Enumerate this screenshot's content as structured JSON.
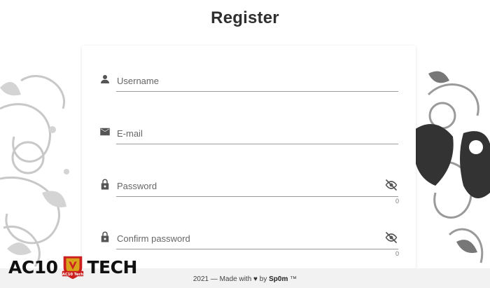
{
  "page": {
    "title": "Register"
  },
  "form": {
    "username": {
      "placeholder": "Username",
      "icon": "person-icon"
    },
    "email": {
      "placeholder": "E-mail",
      "icon": "mail-icon"
    },
    "password": {
      "placeholder": "Password",
      "icon": "lock-icon",
      "counter": "0",
      "toggle_icon": "eye-off-icon"
    },
    "confirm_password": {
      "placeholder": "Confirm password",
      "icon": "lock-icon",
      "counter": "0",
      "toggle_icon": "eye-off-icon"
    }
  },
  "footer": {
    "prefix": "2021 — Made with",
    "heart": "♥",
    "by": "by",
    "author": "Sp0m",
    "tm": "™"
  },
  "watermark": {
    "left": "AC10",
    "badge": "AC10 Tech",
    "right": "TECH"
  },
  "colors": {
    "logo_red": "#cc1f1f",
    "logo_gold": "#d9a21b",
    "text": "#2f2f2f"
  }
}
